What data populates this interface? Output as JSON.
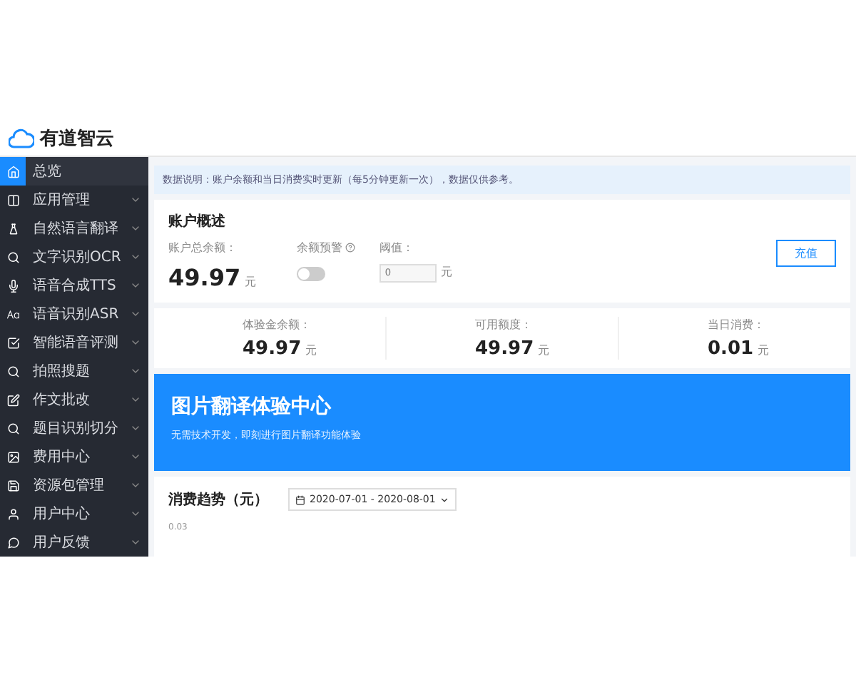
{
  "logo": {
    "text": "有道智云"
  },
  "sidebar": {
    "items": [
      {
        "label": "总览",
        "selected": true,
        "expandable": false
      },
      {
        "label": "应用管理",
        "selected": false,
        "expandable": true
      },
      {
        "label": "自然语言翻译",
        "selected": false,
        "expandable": true
      },
      {
        "label": "文字识别OCR",
        "selected": false,
        "expandable": true
      },
      {
        "label": "语音合成TTS",
        "selected": false,
        "expandable": true
      },
      {
        "label": "语音识别ASR",
        "selected": false,
        "expandable": true
      },
      {
        "label": "智能语音评测",
        "selected": false,
        "expandable": true
      },
      {
        "label": "拍照搜题",
        "selected": false,
        "expandable": true
      },
      {
        "label": "作文批改",
        "selected": false,
        "expandable": true
      },
      {
        "label": "题目识别切分",
        "selected": false,
        "expandable": true
      },
      {
        "label": "费用中心",
        "selected": false,
        "expandable": true
      },
      {
        "label": "资源包管理",
        "selected": false,
        "expandable": true
      },
      {
        "label": "用户中心",
        "selected": false,
        "expandable": true
      },
      {
        "label": "用户反馈",
        "selected": false,
        "expandable": true
      }
    ]
  },
  "notice": "数据说明：账户余额和当日消费实时更新（每5分钟更新一次），数据仅供参考。",
  "overview": {
    "title": "账户概述",
    "balance_label": "账户总余额：",
    "balance": "49.97",
    "balance_unit": "元",
    "alert_label": "余额预警",
    "alert_on": false,
    "threshold_label": "阈值：",
    "threshold_placeholder": "0",
    "threshold_unit": "元",
    "recharge_button": "充值",
    "stats": [
      {
        "label": "体验金余额：",
        "value": "49.97",
        "unit": "元"
      },
      {
        "label": "可用额度：",
        "value": "49.97",
        "unit": "元"
      },
      {
        "label": "当日消费：",
        "value": "0.01",
        "unit": "元"
      }
    ]
  },
  "banner": {
    "title": "图片翻译体验中心",
    "subtitle": "无需技术开发，即刻进行图片翻译功能体验"
  },
  "trend": {
    "title": "消费趋势（元）",
    "date_range": "2020-07-01 - 2020-08-01",
    "y_tick": "0.03"
  }
}
